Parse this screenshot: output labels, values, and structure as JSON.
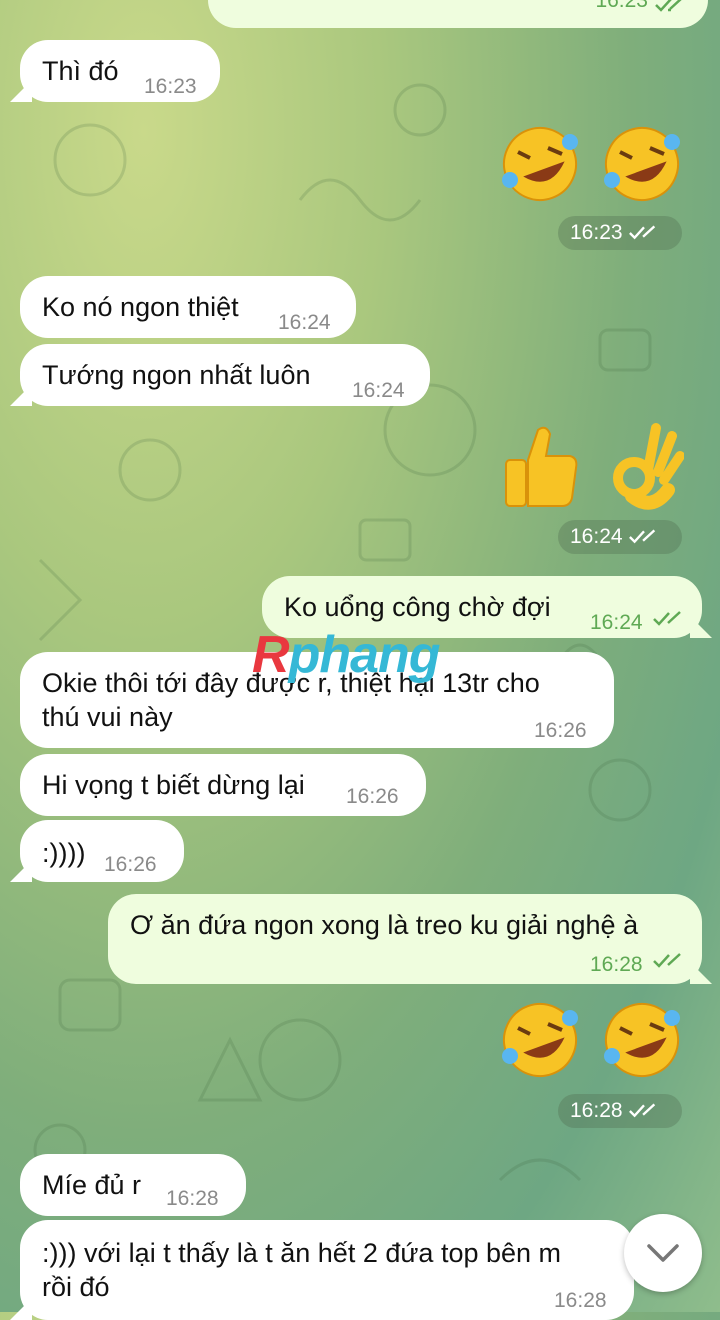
{
  "messages": [
    {
      "id": "m1",
      "text": "Thì đó",
      "time": "16:23"
    },
    {
      "id": "m2",
      "time": "16:23",
      "emoji": "rofl x2"
    },
    {
      "id": "m3",
      "text": "Ko nó ngon thiệt",
      "time": "16:24"
    },
    {
      "id": "m4",
      "text": "Tướng ngon nhất luôn",
      "time": "16:24"
    },
    {
      "id": "m5",
      "time": "16:24",
      "emoji": "thumbs-up, ok-hand"
    },
    {
      "id": "m6",
      "text": "Ko uổng công chờ đợi",
      "time": "16:24"
    },
    {
      "id": "m7",
      "line1": "Okie thôi tới đây được r, thiệt hại 13tr cho",
      "line2": "thú vui này",
      "time": "16:26"
    },
    {
      "id": "m8",
      "text": "Hi vọng t biết dừng lại",
      "time": "16:26"
    },
    {
      "id": "m9",
      "text": ":))))",
      "time": "16:26"
    },
    {
      "id": "m10",
      "text": "Ơ ăn đứa ngon xong là treo ku giải nghệ à",
      "time": "16:28"
    },
    {
      "id": "m11",
      "time": "16:28",
      "emoji": "rofl x2"
    },
    {
      "id": "m12",
      "text": "Míe đủ r",
      "time": "16:28"
    },
    {
      "id": "m13",
      "line1": ":))) với lại t thấy là t ăn hết 2 đứa top bên m",
      "line2": "rồi đó",
      "time": "16:28"
    }
  ],
  "top_partial_time": "16:23",
  "watermark": {
    "part1": "R",
    "part2": "phang"
  },
  "colors": {
    "incoming": "#ffffff",
    "outgoing": "#effdde",
    "tick": "#5fa954"
  },
  "scroll_button": {
    "icon": "chevron-down-icon"
  }
}
